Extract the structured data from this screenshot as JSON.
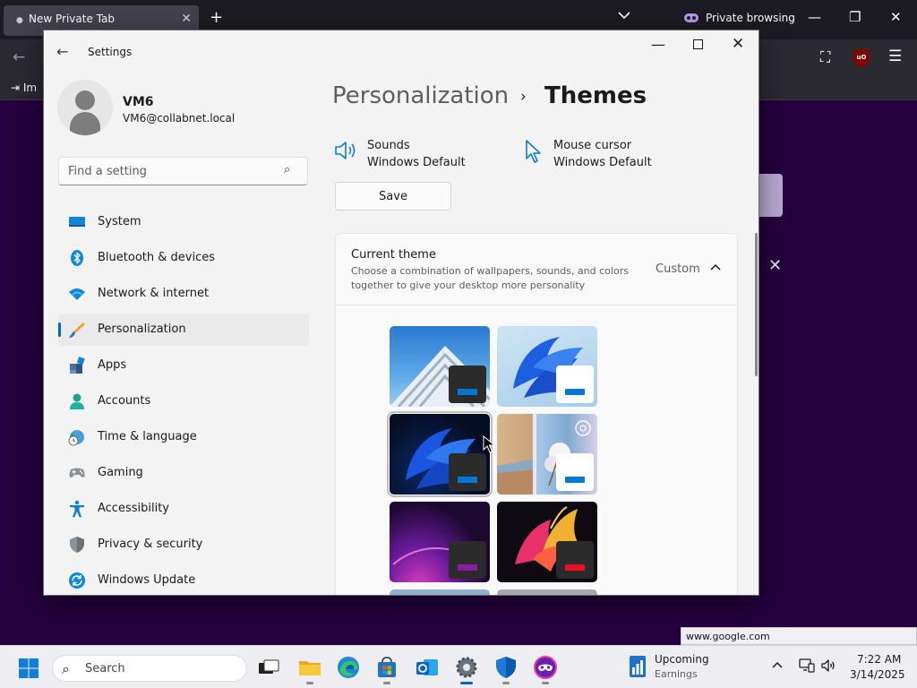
{
  "browser": {
    "tab_title": "New Private Tab",
    "tab_close": "✕",
    "new_tab": "+",
    "tab_list": "⌄",
    "private_label": "Private browsing",
    "minimize": "—",
    "restore": "❐",
    "close": "✕",
    "back": "←",
    "extensions": "⛶",
    "ublock": "uO",
    "menu": "☰",
    "bookmark_import": "⇥ Im",
    "bg_close": "✕",
    "status_url": "www.google.com"
  },
  "settings": {
    "window_title": "Settings",
    "back": "←",
    "minimize": "—",
    "close": "✕",
    "user": {
      "name": "VM6",
      "email": "VM6@collabnet.local"
    },
    "search_placeholder": "Find a setting",
    "search_icon": "⌕",
    "nav": [
      {
        "label": "System",
        "icon": "system-icon"
      },
      {
        "label": "Bluetooth & devices",
        "icon": "bluetooth-icon"
      },
      {
        "label": "Network & internet",
        "icon": "network-icon"
      },
      {
        "label": "Personalization",
        "icon": "personalization-icon",
        "active": true
      },
      {
        "label": "Apps",
        "icon": "apps-icon"
      },
      {
        "label": "Accounts",
        "icon": "accounts-icon"
      },
      {
        "label": "Time & language",
        "icon": "time-language-icon"
      },
      {
        "label": "Gaming",
        "icon": "gaming-icon"
      },
      {
        "label": "Accessibility",
        "icon": "accessibility-icon"
      },
      {
        "label": "Privacy & security",
        "icon": "privacy-shield-icon"
      },
      {
        "label": "Windows Update",
        "icon": "windows-update-icon"
      }
    ],
    "breadcrumb": {
      "parent": "Personalization",
      "separator": "›",
      "current": "Themes"
    },
    "sounds": {
      "title": "Sounds",
      "value": "Windows Default"
    },
    "mouse_cursor": {
      "title": "Mouse cursor",
      "value": "Windows Default"
    },
    "save_label": "Save",
    "current_theme": {
      "title": "Current theme",
      "description": "Choose a combination of wallpapers, sounds, and colors together to give your desktop more personality",
      "value": "Custom",
      "chevron": "︿"
    },
    "themes": [
      {
        "name": "theme-tile-architecture",
        "accent": "#0078d4",
        "swatch": "#2b2b2b"
      },
      {
        "name": "theme-tile-windows-light",
        "accent": "#0078d4",
        "swatch": "#ffffff"
      },
      {
        "name": "theme-tile-windows-dark",
        "accent": "#0078d4",
        "swatch": "#2b2b2b",
        "selected": true
      },
      {
        "name": "theme-tile-spotlight",
        "accent": "#0078d4",
        "swatch": "#ffffff"
      },
      {
        "name": "theme-tile-glow",
        "accent": "#8a1da8",
        "swatch": "#2b2b2b"
      },
      {
        "name": "theme-tile-captured-motion",
        "accent": "#e81123",
        "swatch": "#2b2b2b"
      }
    ]
  },
  "taskbar": {
    "search_label": "Search",
    "search_icon": "⌕",
    "widget_title": "Upcoming",
    "widget_sub": "Earnings",
    "tray_chevron": "︿",
    "time": "7:22 AM",
    "date": "3/14/2025",
    "apps": [
      "task-view-icon",
      "file-explorer-icon",
      "edge-icon",
      "store-icon",
      "outlook-icon",
      "settings-app-icon",
      "defender-icon",
      "firefox-private-icon"
    ]
  },
  "colors": {
    "accent": "#0067c0",
    "browser_bg": "#25003e"
  }
}
